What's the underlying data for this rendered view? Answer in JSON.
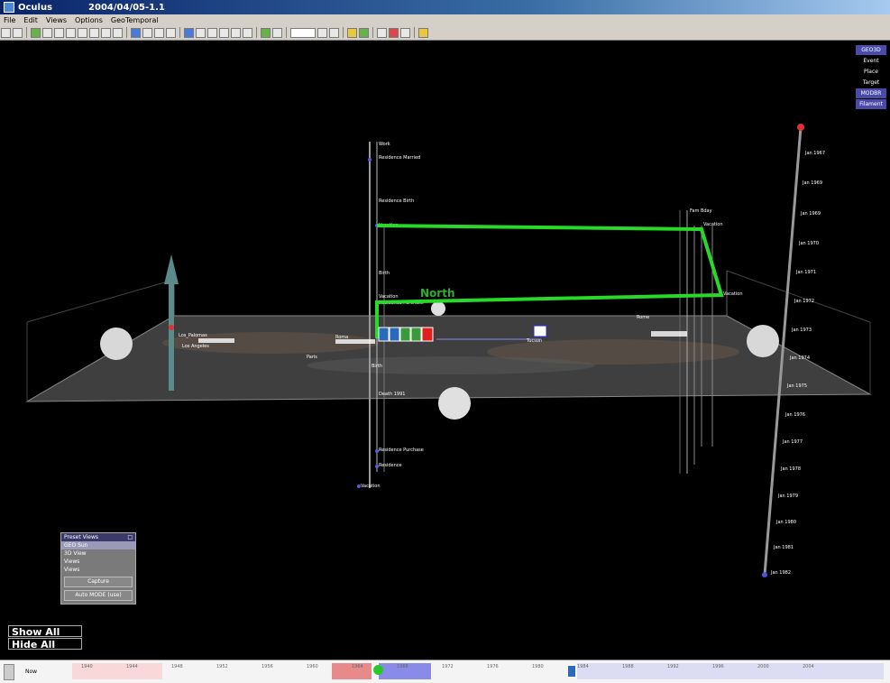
{
  "window": {
    "title": "Oculus",
    "version": "2004/04/05-1.1"
  },
  "menu": {
    "items": [
      "File",
      "Edit",
      "Views",
      "Options",
      "GeoTemporal"
    ]
  },
  "right_menu": {
    "items": [
      "GEO3D",
      "Event",
      "Place",
      "Target",
      "MODBR",
      "Filament"
    ],
    "selected": [
      "GEO3D",
      "MODBR",
      "Filament"
    ]
  },
  "scene": {
    "north_label": "North",
    "left_mast": {
      "labels": [
        "Work",
        "Residence Married",
        "Residence Birth",
        "Vacation",
        "Birth",
        "Vacation",
        "Residence Purchase",
        "Birth",
        "Death 1991",
        "Residence Purchase",
        "Residence",
        "Vacation"
      ]
    },
    "mid_mast": {
      "labels": [
        "Fam Bday",
        "Vacation",
        "Vacation"
      ]
    },
    "timeline_axis": {
      "start_color": "#e03030",
      "end_color": "#5050e0",
      "labels": [
        "Jan 1967",
        "Jan 1969",
        "Jan 1969",
        "Jan 1970",
        "Jan 1971",
        "Jan 1972",
        "Jan 1973",
        "Jan 1974",
        "Jan 1975",
        "Jan 1976",
        "Jan 1977",
        "Jan 1978",
        "Jan 1979",
        "Jan 1980",
        "Jan 1981",
        "Jan 1982"
      ]
    },
    "place_labels": [
      "Los_Palomas",
      "Los Angeles",
      "Paris",
      "Roma",
      "Rome",
      "Tucson"
    ],
    "icons": [
      "person-1",
      "person-2",
      "person-3",
      "person-4",
      "flag"
    ]
  },
  "preset_panel": {
    "title": "Preset Views",
    "items": [
      "GEO Sun",
      "3D View",
      "Views",
      "Views"
    ],
    "capture_label": "Capture",
    "auto_label": "Auto MODE (use)"
  },
  "buttons": {
    "show_all": "Show All",
    "hide_all": "Hide All"
  },
  "timeline": {
    "start_label": "Now",
    "ticks": [
      "1940",
      "1944",
      "1948",
      "1952",
      "1956",
      "1960",
      "1964",
      "1968",
      "1972",
      "1976",
      "1980",
      "1984",
      "1988",
      "1992",
      "1996",
      "2000",
      "2004"
    ]
  }
}
